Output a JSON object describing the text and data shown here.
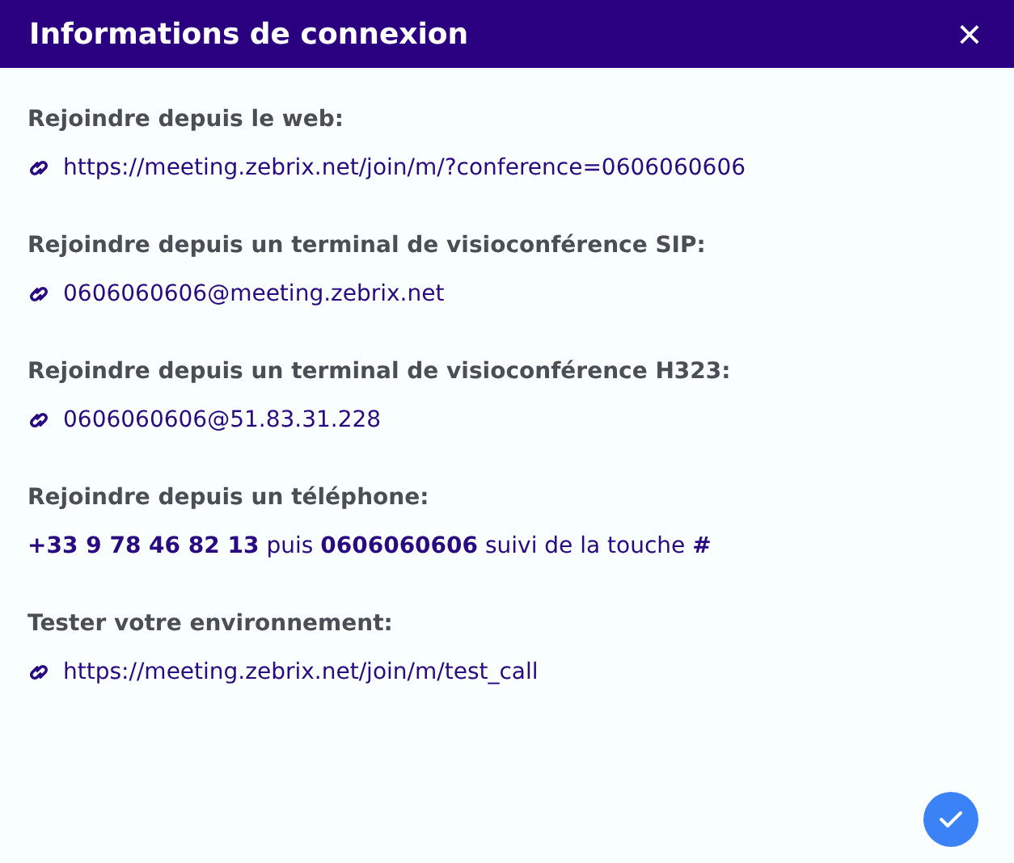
{
  "dialog": {
    "title": "Informations de connexion",
    "close": "×"
  },
  "sections": [
    {
      "label": "Rejoindre depuis le web:",
      "kind": "link",
      "value": "https://meeting.zebrix.net/join/m/?conference=0606060606"
    },
    {
      "label": "Rejoindre depuis un terminal de visioconférence SIP:",
      "kind": "link",
      "value": "0606060606@meeting.zebrix.net"
    },
    {
      "label": "Rejoindre depuis un terminal de visioconférence H323:",
      "kind": "link",
      "value": "0606060606@51.83.31.228"
    },
    {
      "label": "Rejoindre depuis un téléphone:",
      "kind": "text",
      "value": "**+33 9 78 46 82 13** puis **0606060606** suivi de la touche **#**"
    },
    {
      "label": "Tester votre environnement:",
      "kind": "link",
      "value": "https://meeting.zebrix.net/join/m/test_call"
    }
  ]
}
